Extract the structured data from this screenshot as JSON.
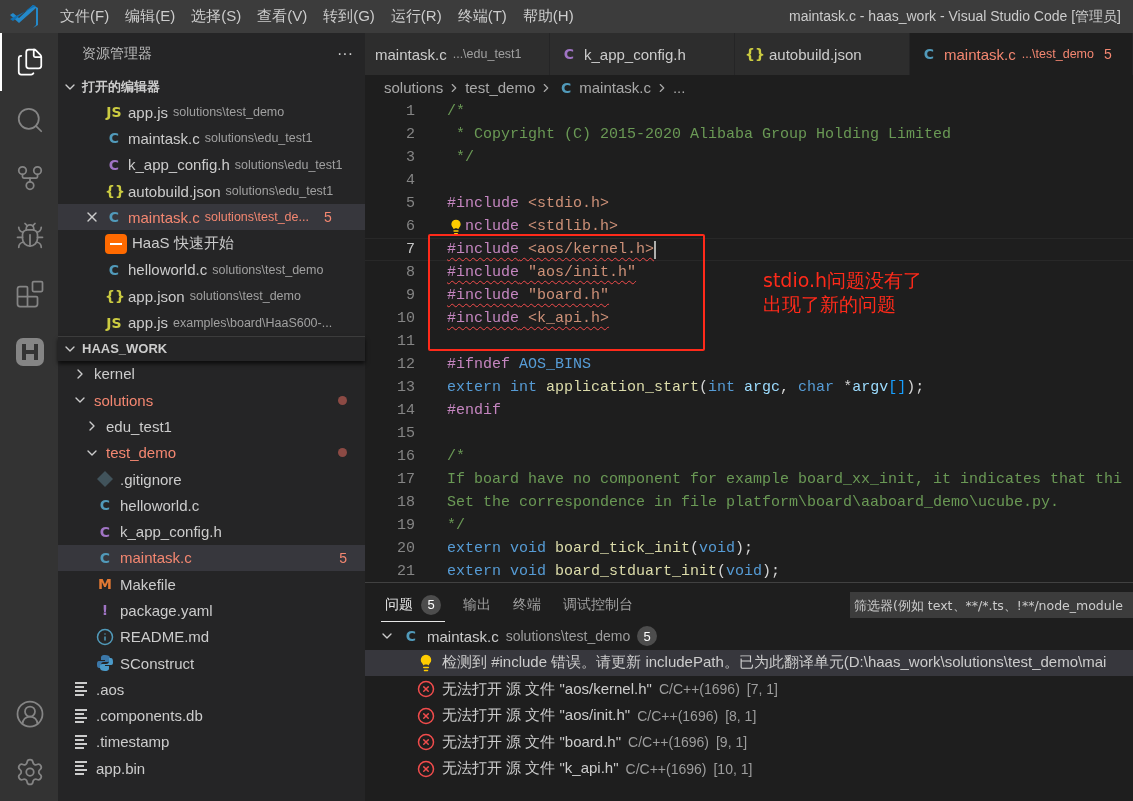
{
  "title_bar": {
    "menus": [
      "文件(F)",
      "编辑(E)",
      "选择(S)",
      "查看(V)",
      "转到(G)",
      "运行(R)",
      "终端(T)",
      "帮助(H)"
    ],
    "title": "maintask.c - haas_work - Visual Studio Code [管理员]"
  },
  "activity_bar": {
    "top": [
      {
        "kind": "explorer",
        "selected": true
      },
      {
        "kind": "search",
        "selected": false
      },
      {
        "kind": "source-control",
        "selected": false
      },
      {
        "kind": "run",
        "selected": false
      },
      {
        "kind": "extensions",
        "selected": false
      },
      {
        "kind": "haas",
        "selected": false
      }
    ],
    "bottom": [
      {
        "kind": "account",
        "selected": false
      },
      {
        "kind": "settings",
        "selected": false
      }
    ]
  },
  "sidebar": {
    "title": "资源管理器",
    "more": "···",
    "open_editors": {
      "title": "打开的编辑器",
      "expanded": true,
      "items": [
        {
          "kind": "js",
          "icon": "JS",
          "name": "app.js",
          "path": "solutions\\test_demo",
          "selected": false
        },
        {
          "kind": "c",
          "icon": "C",
          "name": "maintask.c",
          "path": "solutions\\edu_test1",
          "selected": false
        },
        {
          "kind": "h",
          "icon": "C",
          "name": "k_app_config.h",
          "path": "solutions\\edu_test1",
          "selected": false
        },
        {
          "kind": "json",
          "icon": "{}",
          "name": "autobuild.json",
          "path": "solutions\\edu_test1",
          "selected": false
        },
        {
          "kind": "c",
          "icon": "C",
          "name": "maintask.c",
          "path": "solutions\\test_de...",
          "selected": true,
          "badge": "5"
        },
        {
          "kind": "haas",
          "name": "HaaS 快速开始",
          "selected": false
        },
        {
          "kind": "c",
          "icon": "C",
          "name": "helloworld.c",
          "path": "solutions\\test_demo",
          "selected": false
        },
        {
          "kind": "json",
          "icon": "{}",
          "name": "app.json",
          "path": "solutions\\test_demo",
          "selected": false
        },
        {
          "kind": "js",
          "icon": "JS",
          "name": "app.js",
          "path": "examples\\board\\HaaS600-...",
          "selected": false
        }
      ]
    },
    "workspace": {
      "title": "HAAS_WORK",
      "expanded": true,
      "children": [
        {
          "kind": "folder",
          "name": "kernel",
          "expanded": false
        },
        {
          "kind": "folder",
          "name": "solutions",
          "expanded": true,
          "modified": true,
          "children": [
            {
              "kind": "folder",
              "name": "edu_test1",
              "expanded": false
            },
            {
              "kind": "folder",
              "name": "test_demo",
              "expanded": true,
              "modified": true,
              "children": [
                {
                  "kind": "git",
                  "name": ".gitignore",
                  "selected": false
                },
                {
                  "kind": "c",
                  "icon": "C",
                  "name": "helloworld.c",
                  "selected": false
                },
                {
                  "kind": "h",
                  "icon": "C",
                  "name": "k_app_config.h",
                  "selected": false
                },
                {
                  "kind": "c",
                  "icon": "C",
                  "name": "maintask.c",
                  "selected": true,
                  "badge": "5"
                },
                {
                  "kind": "makefile",
                  "icon": "M",
                  "name": "Makefile",
                  "selected": false
                },
                {
                  "kind": "yaml",
                  "icon": "!",
                  "name": "package.yaml",
                  "selected": false
                },
                {
                  "kind": "info",
                  "name": "README.md",
                  "selected": false
                },
                {
                  "kind": "python",
                  "name": "SConstruct",
                  "selected": false
                }
              ]
            }
          ]
        },
        {
          "kind": "text",
          "name": ".aos",
          "selected": false
        },
        {
          "kind": "text",
          "name": ".components.db",
          "selected": false
        },
        {
          "kind": "text",
          "name": ".timestamp",
          "selected": false
        },
        {
          "kind": "text",
          "name": "app.bin",
          "selected": false
        }
      ]
    }
  },
  "editor": {
    "tabs": [
      {
        "name": "maintask.c",
        "path": "...\\edu_test1",
        "selected": false
      },
      {
        "kind": "h",
        "icon": "C",
        "name": "k_app_config.h",
        "selected": false
      },
      {
        "kind": "json",
        "icon": "{}",
        "name": "autobuild.json",
        "selected": false
      },
      {
        "kind": "c",
        "icon": "C",
        "name": "maintask.c",
        "path": "...\\test_demo",
        "badge": "5",
        "selected": true
      }
    ],
    "breadcrumbs": [
      {
        "label": "solutions"
      },
      {
        "label": "test_demo"
      },
      {
        "kind": "c",
        "icon": "C",
        "label": "maintask.c"
      },
      {
        "label": "..."
      }
    ],
    "lines": [
      {
        "n": "1",
        "tokens": [
          {
            "kind": "comment",
            "text": "/*"
          }
        ]
      },
      {
        "n": "2",
        "tokens": [
          {
            "kind": "comment",
            "text": " * Copyright (C) 2015-2020 Alibaba Group Holding Limited"
          }
        ]
      },
      {
        "n": "3",
        "tokens": [
          {
            "kind": "comment",
            "text": " */"
          }
        ]
      },
      {
        "n": "4"
      },
      {
        "n": "5",
        "tokens": [
          {
            "kind": "preproc",
            "text": "#include"
          },
          {
            "kind": "string",
            "text": " <stdio.h>"
          }
        ]
      },
      {
        "n": "6",
        "bulb": true,
        "tokens": [
          {
            "kind": "preproc",
            "text": "nclude"
          },
          {
            "kind": "string",
            "text": " <stdlib.h>"
          }
        ]
      },
      {
        "n": "7",
        "current": true,
        "squiggle": true,
        "tokens": [
          {
            "kind": "preproc",
            "text": "#include"
          },
          {
            "kind": "string",
            "text": " <aos/kernel.h>"
          }
        ]
      },
      {
        "n": "8",
        "squiggle": true,
        "tokens": [
          {
            "kind": "preproc",
            "text": "#include"
          },
          {
            "kind": "string",
            "text": " \"aos/init.h\""
          }
        ]
      },
      {
        "n": "9",
        "squiggle": true,
        "tokens": [
          {
            "kind": "preproc",
            "text": "#include"
          },
          {
            "kind": "string",
            "text": " \"board.h\""
          }
        ]
      },
      {
        "n": "10",
        "squiggle": true,
        "tokens": [
          {
            "kind": "preproc",
            "text": "#include"
          },
          {
            "kind": "string",
            "text": " <k_api.h>"
          }
        ]
      },
      {
        "n": "11"
      },
      {
        "n": "12",
        "tokens": [
          {
            "kind": "preproc",
            "text": "#ifndef"
          },
          {
            "kind": "keyword",
            "text": " AOS_BINS"
          }
        ]
      },
      {
        "n": "13",
        "tokens": [
          {
            "kind": "keyword",
            "text": "extern int"
          },
          {
            "kind": "func",
            "text": " application_start"
          },
          {
            "kind": "plain",
            "text": "("
          },
          {
            "kind": "keyword",
            "text": "int"
          },
          {
            "kind": "param",
            "text": " argc"
          },
          {
            "kind": "plain",
            "text": ","
          },
          {
            "kind": "keyword",
            "text": " char"
          },
          {
            "kind": "plain",
            "text": " *"
          },
          {
            "kind": "param",
            "text": "argv"
          },
          {
            "kind": "bracket",
            "text": "[]"
          },
          {
            "kind": "plain",
            "text": ");"
          }
        ]
      },
      {
        "n": "14",
        "tokens": [
          {
            "kind": "preproc",
            "text": "#endif"
          }
        ]
      },
      {
        "n": "15"
      },
      {
        "n": "16",
        "tokens": [
          {
            "kind": "comment",
            "text": "/*"
          }
        ]
      },
      {
        "n": "17",
        "tokens": [
          {
            "kind": "comment",
            "text": "If board have no component for example board_xx_init, it indicates that thi"
          }
        ]
      },
      {
        "n": "18",
        "tokens": [
          {
            "kind": "comment",
            "text": "Set the correspondence in file platform\\board\\aaboard_demo\\ucube.py."
          }
        ]
      },
      {
        "n": "19",
        "tokens": [
          {
            "kind": "comment",
            "text": "*/"
          }
        ]
      },
      {
        "n": "20",
        "tokens": [
          {
            "kind": "keyword",
            "text": "extern void"
          },
          {
            "kind": "func",
            "text": " board_tick_init"
          },
          {
            "kind": "plain",
            "text": "("
          },
          {
            "kind": "keyword",
            "text": "void"
          },
          {
            "kind": "plain",
            "text": ");"
          }
        ]
      },
      {
        "n": "21",
        "tokens": [
          {
            "kind": "keyword",
            "text": "extern void"
          },
          {
            "kind": "func",
            "text": " board_stduart_init"
          },
          {
            "kind": "plain",
            "text": "("
          },
          {
            "kind": "keyword",
            "text": "void"
          },
          {
            "kind": "plain",
            "text": ");"
          }
        ]
      }
    ],
    "annotation": {
      "lines": [
        "stdio.h问题没有了",
        "出现了新的问题"
      ]
    }
  },
  "panel": {
    "tabs": [
      {
        "label": "问题",
        "badge": "5",
        "selected": true
      },
      {
        "label": "输出",
        "selected": false
      },
      {
        "label": "终端",
        "selected": false
      },
      {
        "label": "调试控制台",
        "selected": false
      }
    ],
    "filter": {
      "placeholder": "筛选器(例如 text、**/*.ts、!**/node_module"
    },
    "group": {
      "kind": "c",
      "icon": "C",
      "file": "maintask.c",
      "path": "solutions\\test_demo",
      "count": "5",
      "expanded": true,
      "items": [
        {
          "kind": "info",
          "message": "检测到 #include 错误。请更新 includePath。已为此翻译单元(D:\\haas_work\\solutions\\test_demo\\mai",
          "selected": true
        },
        {
          "kind": "error",
          "message": "无法打开 源 文件 \"aos/kernel.h\"",
          "source": "C/C++(1696)",
          "pos": "[7, 1]",
          "selected": false
        },
        {
          "kind": "error",
          "message": "无法打开 源 文件 \"aos/init.h\"",
          "source": "C/C++(1696)",
          "pos": "[8, 1]",
          "selected": false
        },
        {
          "kind": "error",
          "message": "无法打开 源 文件 \"board.h\"",
          "source": "C/C++(1696)",
          "pos": "[9, 1]",
          "selected": false
        },
        {
          "kind": "error",
          "message": "无法打开 源 文件 \"k_api.h\"",
          "source": "C/C++(1696)",
          "pos": "[10, 1]",
          "selected": false
        }
      ]
    }
  }
}
